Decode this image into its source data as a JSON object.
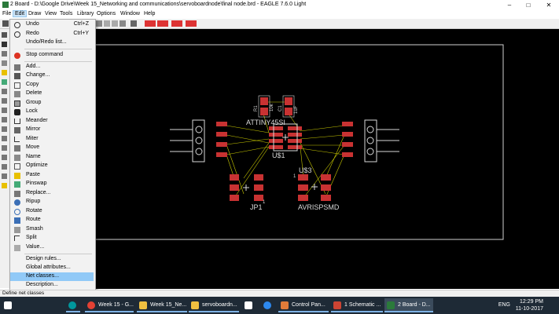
{
  "window": {
    "title": "2 Board - D:\\Google Drive\\Week 15_Networking and communications\\servoboardnode\\final node.brd - EAGLE 7.6.0 Light",
    "controls": [
      "minimize-icon",
      "maximize-icon",
      "close-icon"
    ]
  },
  "menubar": {
    "items": [
      "File",
      "Edit",
      "Draw",
      "View",
      "Tools",
      "Library",
      "Options",
      "Window",
      "Help"
    ],
    "active": "Edit"
  },
  "edit_menu": {
    "items": [
      {
        "label": "Undo",
        "shortcut": "Ctrl+Z",
        "icon": "undo-icon"
      },
      {
        "label": "Redo",
        "shortcut": "Ctrl+Y",
        "icon": "redo-icon"
      },
      {
        "label": "Undo/Redo list...",
        "shortcut": "",
        "icon": ""
      },
      {
        "label": "Stop command",
        "shortcut": "",
        "icon": "stop-icon"
      },
      {
        "label": "Add...",
        "shortcut": "",
        "icon": "add-icon"
      },
      {
        "label": "Change...",
        "shortcut": "",
        "icon": "change-icon"
      },
      {
        "label": "Copy",
        "shortcut": "",
        "icon": "copy-icon"
      },
      {
        "label": "Delete",
        "shortcut": "",
        "icon": "delete-icon"
      },
      {
        "label": "Group",
        "shortcut": "",
        "icon": "group-icon"
      },
      {
        "label": "Lock",
        "shortcut": "",
        "icon": "lock-icon"
      },
      {
        "label": "Meander",
        "shortcut": "",
        "icon": "meander-icon"
      },
      {
        "label": "Mirror",
        "shortcut": "",
        "icon": "mirror-icon"
      },
      {
        "label": "Miter",
        "shortcut": "",
        "icon": "miter-icon"
      },
      {
        "label": "Move",
        "shortcut": "",
        "icon": "move-icon"
      },
      {
        "label": "Name",
        "shortcut": "",
        "icon": "name-icon"
      },
      {
        "label": "Optimize",
        "shortcut": "",
        "icon": "optimize-icon"
      },
      {
        "label": "Paste",
        "shortcut": "",
        "icon": "paste-icon"
      },
      {
        "label": "Pinswap",
        "shortcut": "",
        "icon": "pinswap-icon"
      },
      {
        "label": "Replace...",
        "shortcut": "",
        "icon": "replace-icon"
      },
      {
        "label": "Ripup",
        "shortcut": "",
        "icon": "ripup-icon"
      },
      {
        "label": "Rotate",
        "shortcut": "",
        "icon": "rotate-icon"
      },
      {
        "label": "Route",
        "shortcut": "",
        "icon": "route-icon"
      },
      {
        "label": "Smash",
        "shortcut": "",
        "icon": "smash-icon"
      },
      {
        "label": "Split",
        "shortcut": "",
        "icon": "split-icon"
      },
      {
        "label": "Value...",
        "shortcut": "",
        "icon": "value-icon"
      },
      {
        "label": "Design rules...",
        "shortcut": "",
        "icon": ""
      },
      {
        "label": "Global attributes...",
        "shortcut": "",
        "icon": ""
      },
      {
        "label": "Net classes...",
        "shortcut": "",
        "icon": ""
      },
      {
        "label": "Description...",
        "shortcut": "",
        "icon": ""
      }
    ],
    "highlighted": "Net classes..."
  },
  "board": {
    "labels": {
      "mcu": "ATTINY45SI",
      "mcu_ref": "U$1",
      "r1": "R1",
      "r1_val": "10k",
      "c1": "C1",
      "c1_val": "1uF",
      "jp1": "JP1",
      "isp_ref": "U$3",
      "isp": "AVRISPSMD",
      "pin1_a": "1",
      "pin1_b": "1"
    },
    "colors": {
      "pad": "#c83232",
      "silk": "#d8d8d8",
      "airwire": "#c8c800",
      "outline": "#d0d0d0"
    }
  },
  "statusbar": {
    "text": "Define net classes"
  },
  "taskbar": {
    "apps": [
      {
        "label": "",
        "icon": "arduino-icon"
      },
      {
        "label": "Week 15 - G...",
        "icon": "chrome-icon"
      },
      {
        "label": "Week 15_Ne...",
        "icon": "folder-icon"
      },
      {
        "label": "servoboardn...",
        "icon": "folder-icon"
      },
      {
        "label": "",
        "icon": "store-icon"
      },
      {
        "label": "",
        "icon": "edge-icon"
      },
      {
        "label": "Control Pan...",
        "icon": "control-panel-icon"
      },
      {
        "label": "1 Schematic ...",
        "icon": "eagle-icon"
      },
      {
        "label": "2 Board - D...",
        "icon": "eagle-icon"
      }
    ],
    "language": "ENG",
    "time": "12:29 PM",
    "date": "11-10-2017"
  }
}
